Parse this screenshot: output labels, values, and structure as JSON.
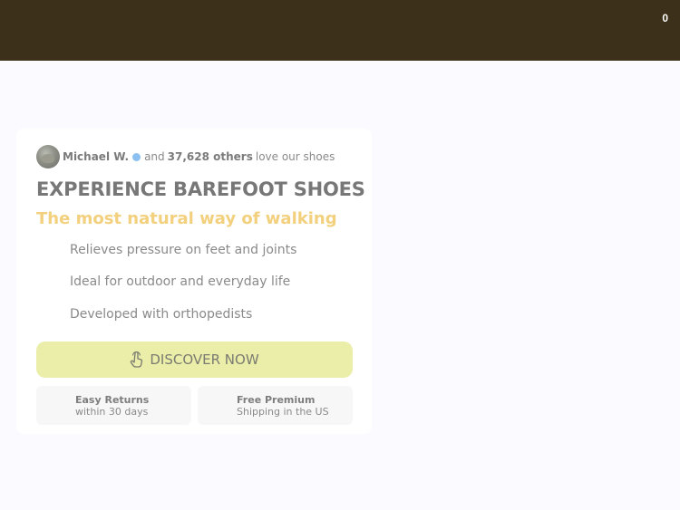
{
  "header": {
    "cart_count": "0"
  },
  "social_proof": {
    "name": "Michael W.",
    "and_text": "and",
    "count": "37,628 others",
    "suffix": "love our shoes"
  },
  "hero": {
    "headline": "EXPERIENCE BAREFOOT SHOES",
    "subheadline": "The most natural way of walking",
    "benefits": [
      "Relieves pressure on feet and joints",
      "Ideal for outdoor and everyday life",
      "Developed with orthopedists"
    ],
    "cta_label": "DISCOVER NOW"
  },
  "badges": [
    {
      "title": "Easy Returns",
      "subtitle": "within 30 days"
    },
    {
      "title": "Free Premium",
      "subtitle": "Shipping in the US"
    }
  ],
  "colors": {
    "topbar": "#3c301b",
    "accent_yellow": "#f2d07d",
    "cta_bg": "#eaeea8"
  },
  "icons": {
    "cta": "hand-pointer-icon",
    "verified": "verified-badge-icon"
  }
}
